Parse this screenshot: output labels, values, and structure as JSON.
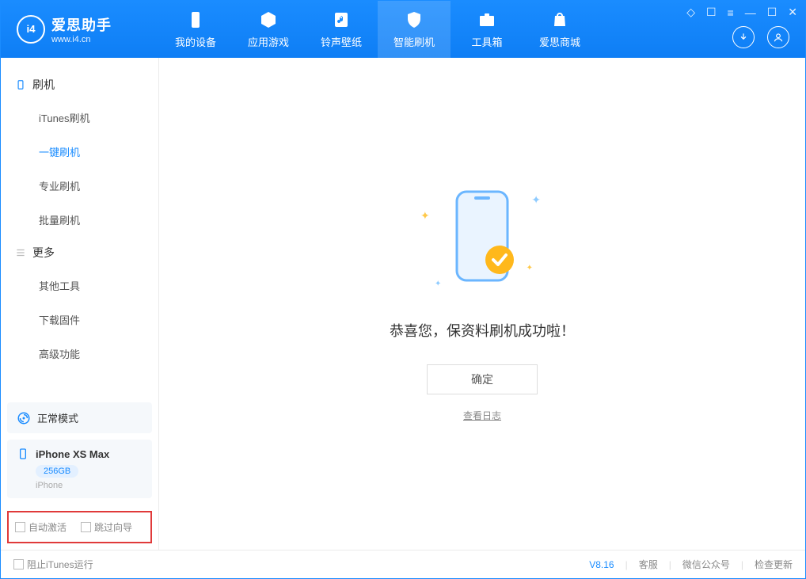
{
  "app": {
    "title": "爱思助手",
    "subtitle": "www.i4.cn"
  },
  "nav": {
    "device": "我的设备",
    "apps": "应用游戏",
    "ringtone": "铃声壁纸",
    "flash": "智能刷机",
    "toolbox": "工具箱",
    "store": "爱思商城"
  },
  "sidebar": {
    "group_flash": "刷机",
    "items_flash": {
      "itunes": "iTunes刷机",
      "onekey": "一键刷机",
      "pro": "专业刷机",
      "batch": "批量刷机"
    },
    "group_more": "更多",
    "items_more": {
      "other": "其他工具",
      "firmware": "下载固件",
      "advanced": "高级功能"
    }
  },
  "device": {
    "mode": "正常模式",
    "name": "iPhone XS Max",
    "storage": "256GB",
    "type": "iPhone"
  },
  "options": {
    "auto_activate": "自动激活",
    "skip_guide": "跳过向导"
  },
  "main": {
    "success_msg": "恭喜您，保资料刷机成功啦！",
    "confirm": "确定",
    "view_log": "查看日志"
  },
  "footer": {
    "block_itunes": "阻止iTunes运行",
    "version": "V8.16",
    "support": "客服",
    "wechat": "微信公众号",
    "update": "检查更新"
  }
}
